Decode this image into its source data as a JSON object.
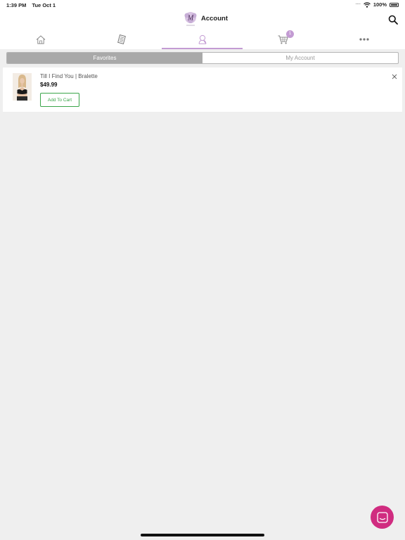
{
  "status_bar": {
    "time": "1:39 PM",
    "date": "Tue Oct 1",
    "battery_text": "100%"
  },
  "header": {
    "title": "Account",
    "logo_letter": "M"
  },
  "tabs": [
    {
      "name": "home",
      "icon": "home-icon"
    },
    {
      "name": "catalog",
      "icon": "catalog-icon"
    },
    {
      "name": "account",
      "icon": "user-icon",
      "active": true
    },
    {
      "name": "cart",
      "icon": "cart-icon",
      "badge": "1"
    },
    {
      "name": "more",
      "icon": "more-icon"
    }
  ],
  "segments": {
    "favorites": "Favorites",
    "my_account": "My Account"
  },
  "favorites": [
    {
      "name": "Till I Find You | Bralette",
      "price": "$49.99",
      "button": "Add To Cart"
    }
  ],
  "colors": {
    "accent": "#c39bd3",
    "add_to_cart": "#3aa54a",
    "chat": "#d02c80"
  }
}
